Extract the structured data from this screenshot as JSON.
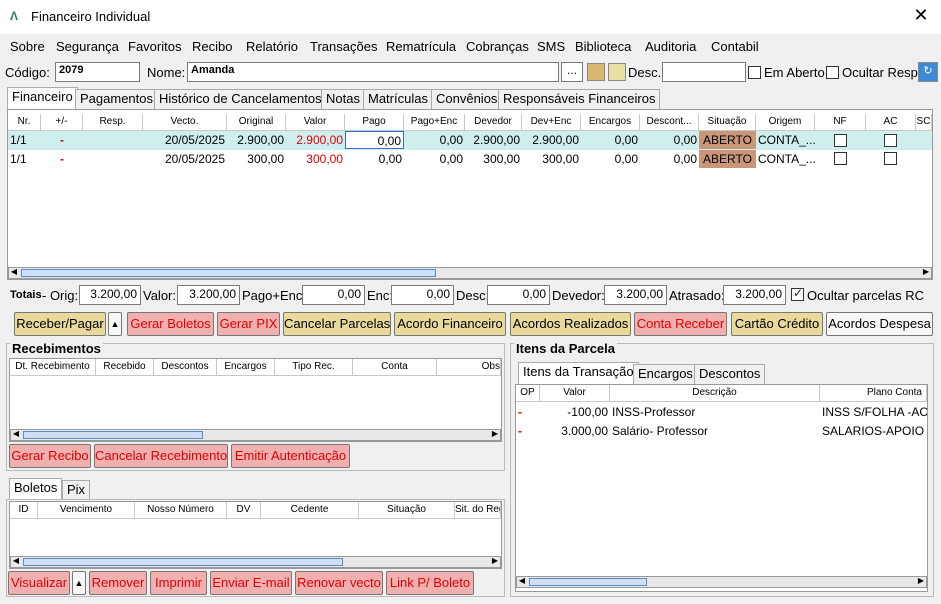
{
  "window": {
    "title": "Financeiro Individual",
    "logo": "Λ",
    "close": "✕"
  },
  "menu": [
    "Sobre",
    "Segurança",
    "Favoritos",
    "Recibo",
    "Relatório",
    "Transações",
    "Rematrícula",
    "Cobranças",
    "SMS",
    "Biblioteca",
    "Auditoria",
    "Contabil"
  ],
  "header": {
    "codigo_label": "Código:",
    "codigo": "2079",
    "nome_label": "Nome:",
    "nome": "Amanda",
    "ellipsis": "...",
    "desc_label": "Desc.:",
    "desc": "",
    "em_aberto": "Em Aberto",
    "ocultar_resp": "Ocultar Resp."
  },
  "tabs": [
    "Financeiro",
    "Pagamentos",
    "Histórico de Cancelamentos",
    "Notas",
    "Matrículas",
    "Convênios",
    "Responsáveis Financeiros"
  ],
  "table": {
    "columns": [
      "Nr.",
      "+/-",
      "Resp.",
      "Vecto.",
      "Original",
      "Valor",
      "Pago",
      "Pago+Enc",
      "Devedor",
      "Dev+Enc",
      "Encargos",
      "Descont...",
      "Situação",
      "Origem",
      "NF",
      "AC",
      "SC"
    ],
    "rows": [
      {
        "nr": "1/1",
        "pm": "-",
        "resp": "",
        "vecto": "20/05/2025",
        "original": "2.900,00",
        "valor": "2.900,00",
        "pago": "0,00",
        "pago_enc": "0,00",
        "devedor": "2.900,00",
        "dev_enc": "2.900,00",
        "encargos": "0,00",
        "desconto": "0,00",
        "situacao": "ABERTO",
        "origem": "CONTA_..."
      },
      {
        "nr": "1/1",
        "pm": "-",
        "resp": "",
        "vecto": "20/05/2025",
        "original": "300,00",
        "valor": "300,00",
        "pago": "0,00",
        "pago_enc": "0,00",
        "devedor": "300,00",
        "dev_enc": "300,00",
        "encargos": "0,00",
        "desconto": "0,00",
        "situacao": "ABERTO",
        "origem": "CONTA_..."
      }
    ]
  },
  "totais": {
    "label": "Totais",
    "orig_label": "- Orig:",
    "orig": "3.200,00",
    "valor_label": "Valor:",
    "valor": "3.200,00",
    "pagoenc_label": "Pago+Enc:",
    "pagoenc": "0,00",
    "enc_label": "Enc:",
    "enc": "0,00",
    "desc_label": "Desc:",
    "desc": "0,00",
    "devedor_label": "Devedor:",
    "devedor": "3.200,00",
    "atrasado_label": "Atrasado:",
    "atrasado": "3.200,00",
    "ocultar_rc": "Ocultar parcelas RC"
  },
  "actions": {
    "receber": "Receber/Pagar",
    "gerar_boletos": "Gerar Boletos",
    "gerar_pix": "Gerar PIX",
    "cancelar_parcelas": "Cancelar Parcelas",
    "acordo_fin": "Acordo Financeiro",
    "acordos_real": "Acordos Realizados",
    "conta_receber": "Conta Receber",
    "cartao": "Cartão Crédito",
    "acordos_desp": "Acordos Despesa"
  },
  "recebimentos": {
    "title": "Recebimentos",
    "columns": [
      "Dt. Recebimento",
      "Recebido",
      "Descontos",
      "Encargos",
      "Tipo Rec.",
      "Conta",
      "Obs"
    ],
    "gerar_recibo": "Gerar Recibo",
    "cancelar": "Cancelar Recebimento",
    "emitir": "Emitir Autenticação"
  },
  "boletos": {
    "tabs": [
      "Boletos",
      "Pix"
    ],
    "columns": [
      "ID",
      "Vencimento",
      "Nosso Número",
      "DV",
      "Cedente",
      "Situação",
      "Sit. do Reg"
    ],
    "visualizar": "Visualizar",
    "remover": "Remover",
    "imprimir": "Imprimir",
    "enviar": "Enviar E-mail",
    "renovar": "Renovar vecto",
    "link": "Link P/ Boleto"
  },
  "itens": {
    "title": "Itens da Parcela",
    "tabs": [
      "Itens da Transação",
      "Encargos",
      "Descontos"
    ],
    "columns": [
      "OP",
      "Valor",
      "Descrição",
      "Plano Conta"
    ],
    "rows": [
      {
        "op": "-",
        "valor": "-100,00",
        "descricao": "INSS-Professor",
        "plano": "INSS S/FOLHA -AC"
      },
      {
        "op": "-",
        "valor": "3.000,00",
        "descricao": "Salário- Professor",
        "plano": "SALARIOS-APOIO A"
      }
    ]
  }
}
